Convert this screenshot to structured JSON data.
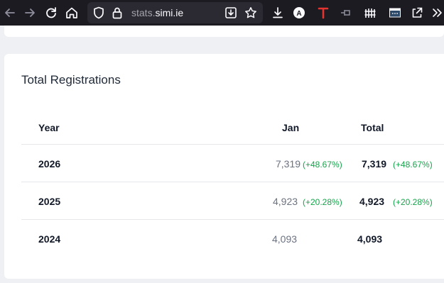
{
  "browser": {
    "url_prefix": "stats.",
    "url_domain": "simi.ie",
    "icons": [
      "back-icon",
      "forward-icon",
      "reload-icon",
      "home-icon",
      "shield-icon",
      "lock-icon",
      "download-page-icon",
      "star-icon",
      "downloads-icon",
      "account-a-icon",
      "extension-t-icon",
      "pin-icon",
      "fence-icon",
      "terminal-icon",
      "share-icon",
      "overflow-icon"
    ]
  },
  "card": {
    "title": "Total Registrations",
    "headers": {
      "year": "Year",
      "jan": "Jan",
      "total": "Total"
    },
    "rows": [
      {
        "year": "2026",
        "jan": "7,319",
        "jan_change": "(+48.67%)",
        "total": "7,319",
        "total_change": "(+48.67%)"
      },
      {
        "year": "2025",
        "jan": "4,923",
        "jan_change": "(+20.28%)",
        "total": "4,923",
        "total_change": "(+20.28%)"
      },
      {
        "year": "2024",
        "jan": "4,093",
        "jan_change": "",
        "total": "4,093",
        "total_change": ""
      }
    ]
  },
  "colors": {
    "toolbar_bg": "#1c1b22",
    "urlbar_bg": "#2b2a33",
    "positive_change": "#16a34a",
    "t_extension": "#e3342f"
  }
}
